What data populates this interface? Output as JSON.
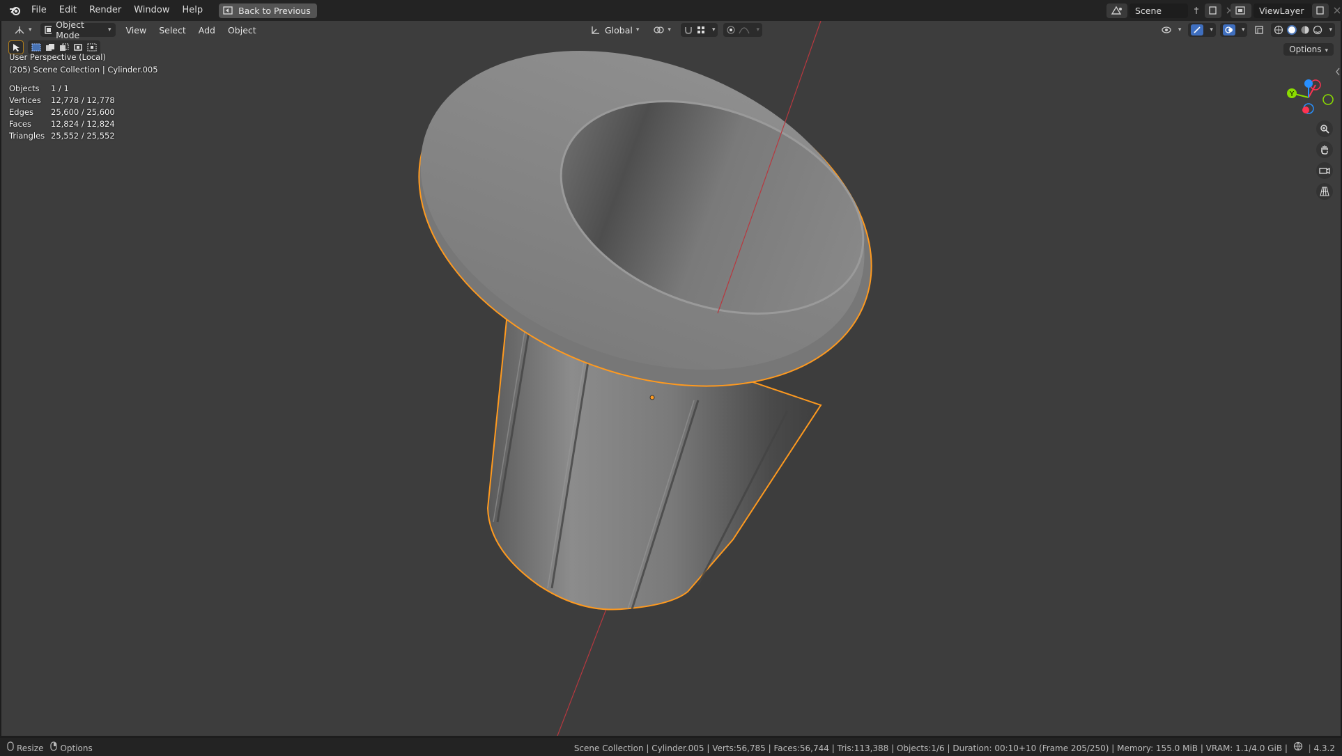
{
  "topbar": {
    "menus": [
      "File",
      "Edit",
      "Render",
      "Window",
      "Help"
    ],
    "back_button": "Back to Previous",
    "scene_name": "Scene",
    "view_layer": "ViewLayer"
  },
  "viewport_header": {
    "mode": "Object Mode",
    "menus": [
      "View",
      "Select",
      "Add",
      "Object"
    ],
    "transform_orientation": "Global",
    "options_label": "Options"
  },
  "overlay": {
    "view_name": "User Perspective (Local)",
    "collection_info": "(205) Scene Collection | Cylinder.005",
    "stats": [
      {
        "label": "Objects",
        "value": "1 / 1"
      },
      {
        "label": "Vertices",
        "value": "12,778 / 12,778"
      },
      {
        "label": "Edges",
        "value": "25,600 / 25,600"
      },
      {
        "label": "Faces",
        "value": "12,824 / 12,824"
      },
      {
        "label": "Triangles",
        "value": "25,552 / 25,552"
      }
    ]
  },
  "gizmo": {
    "y_label": "Y",
    "colors": {
      "x": "#ff3352",
      "y": "#8bdc00",
      "z": "#2890ff"
    }
  },
  "statusbar": {
    "resize_label": "Resize",
    "options_label": "Options",
    "info": "Scene Collection | Cylinder.005 | Verts:56,785 | Faces:56,744 | Tris:113,388 | Objects:1/6 | Duration: 00:10+10 (Frame 205/250) | Memory: 155.0 MiB | VRAM: 1.1/4.0 GiB |",
    "version": "4.3.2"
  },
  "colors": {
    "accent_selection": "#ff9a1f",
    "viewport_bg": "#3d3d3d",
    "object_grey": "#8a8a8a"
  }
}
